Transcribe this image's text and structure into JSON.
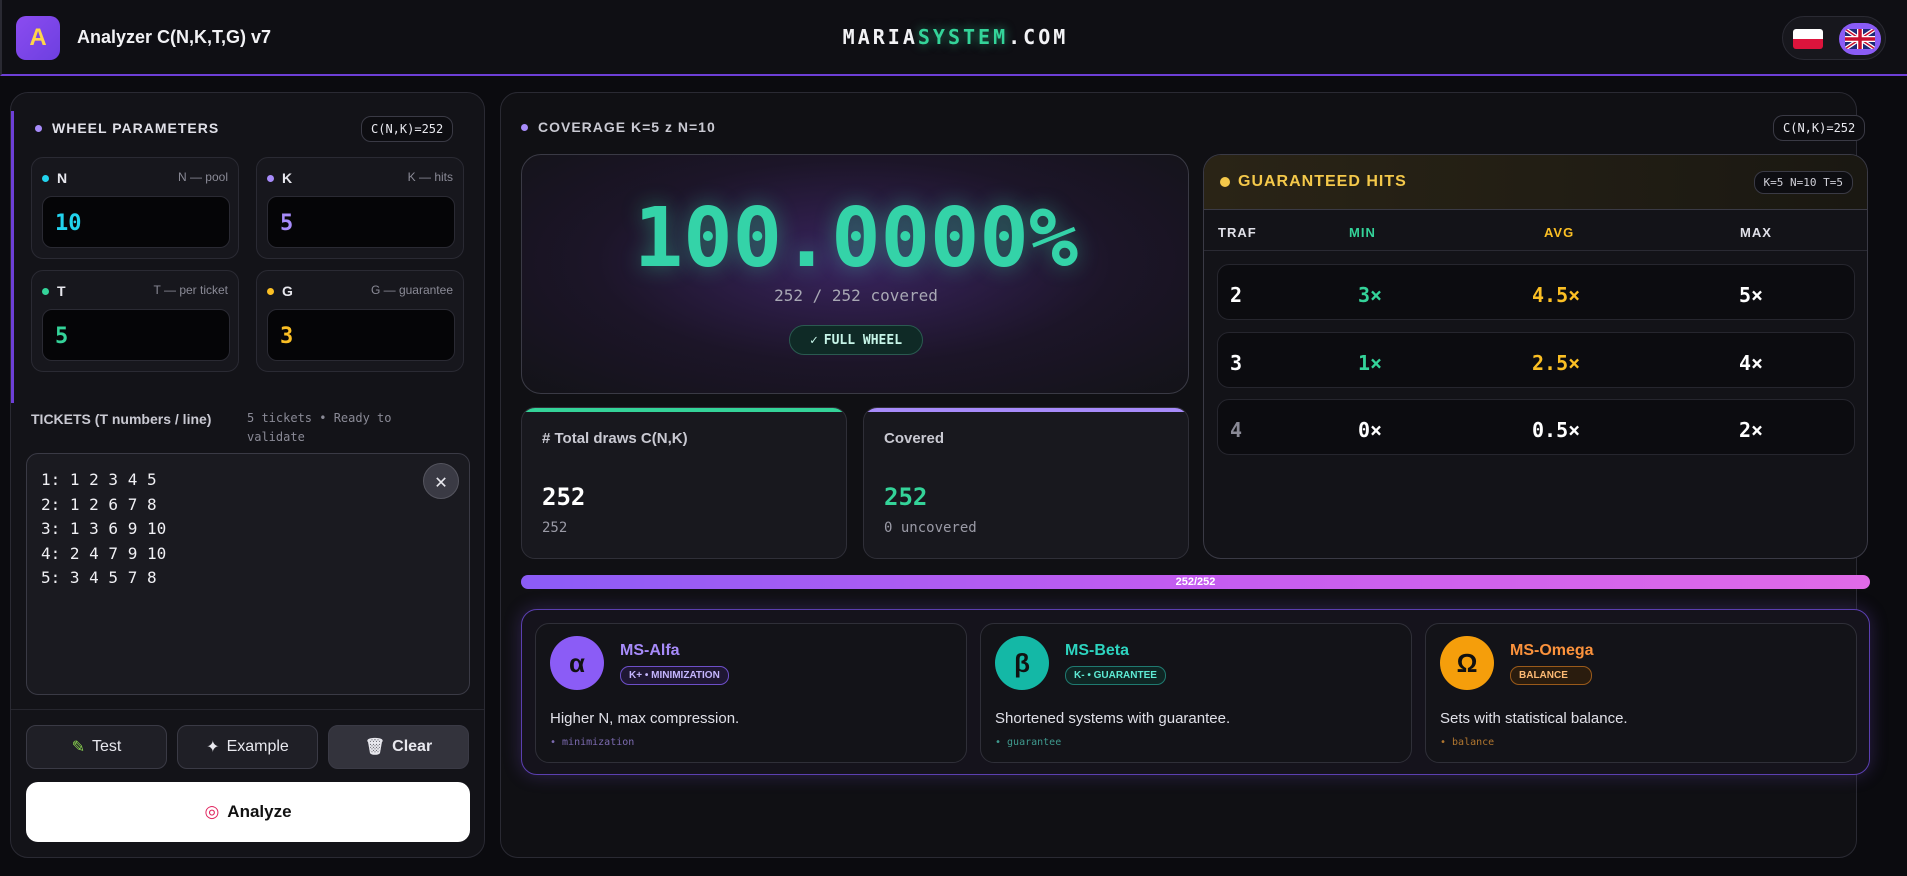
{
  "header": {
    "logo_letter": "A",
    "app_title": "Analyzer C(N,K,T,G) v7",
    "brand_prefix": "MARIA",
    "brand_accent": "SYSTEM",
    "brand_suffix": ".COM",
    "languages": [
      "pl",
      "en"
    ],
    "active_language": "en"
  },
  "params": {
    "title": "WHEEL PARAMETERS",
    "badge": "C(N,K)=252",
    "N": {
      "label": "N",
      "hint": "N — pool",
      "value": "10",
      "color": "#22d3ee"
    },
    "K": {
      "label": "K",
      "hint": "K — hits",
      "value": "5",
      "color": "#a78bfa"
    },
    "T": {
      "label": "T",
      "hint": "T — per ticket",
      "value": "5",
      "color": "#34d399"
    },
    "G": {
      "label": "G",
      "hint": "G — guarantee",
      "value": "3",
      "color": "#fbbf24"
    }
  },
  "tickets": {
    "title": "TICKETS (T numbers / line)",
    "status": "5 tickets • Ready to validate",
    "lines": [
      "1: 1 2 3 4 5",
      "2: 1 2 6 7 8",
      "3: 1 3 6 9 10",
      "4: 2 4 7 9 10",
      "5: 3 4 5 7 8"
    ]
  },
  "actions": {
    "test": "Test",
    "example": "Example",
    "clear": "Clear",
    "analyze": "Analyze"
  },
  "coverage": {
    "title": "COVERAGE K=5 z N=10",
    "badge": "C(N,K)=252",
    "percent": "100.0000%",
    "covered_text": "252 / 252 covered",
    "full_badge": "FULL WHEEL",
    "total": {
      "label": "# Total draws C(N,K)",
      "value": "252",
      "sub": "252"
    },
    "covered": {
      "label": "Covered",
      "value": "252",
      "sub": "0 uncovered"
    },
    "progress_label": "252/252",
    "progress_fraction": 1.0
  },
  "hits": {
    "title": "GUARANTEED HITS",
    "badge": "K=5 N=10 T=5",
    "columns": [
      "TRAF",
      "MIN",
      "AVG",
      "MAX"
    ],
    "rows": [
      {
        "traf": "2",
        "min": "3×",
        "avg": "4.5×",
        "max": "5×"
      },
      {
        "traf": "3",
        "min": "1×",
        "avg": "2.5×",
        "max": "4×"
      },
      {
        "traf": "4",
        "min": "0×",
        "avg": "0.5×",
        "max": "2×"
      }
    ]
  },
  "systems": [
    {
      "icon": "α",
      "name": "MS-Alfa",
      "tag": "K+ • MINIMIZATION",
      "desc": "Higher N, max compression.",
      "note": "• minimization",
      "color": "#8b5cf6"
    },
    {
      "icon": "β",
      "name": "MS-Beta",
      "tag": "K- • GUARANTEE",
      "desc": "Shortened systems with guarantee.",
      "note": "• guarantee",
      "color": "#14b8a6"
    },
    {
      "icon": "Ω",
      "name": "MS-Omega",
      "tag": "BALANCE",
      "desc": "Sets with statistical balance.",
      "note": "• balance",
      "color": "#f59e0b"
    }
  ]
}
